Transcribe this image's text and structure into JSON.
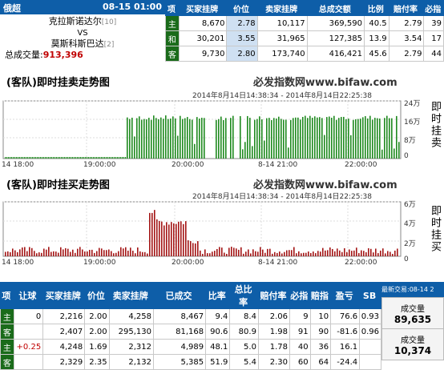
{
  "match": {
    "league": "俄超",
    "datetime": "08-15 01:00",
    "home": "克拉斯诺达尔",
    "home_rank": "[10]",
    "vs": "VS",
    "away": "莫斯科斯巴达",
    "away_rank": "[2]",
    "total_label": "总成交量:",
    "total_value": "913,396"
  },
  "top_table": {
    "headers": [
      "项",
      "买家挂牌",
      "价位",
      "卖家挂牌",
      "总成交额",
      "比例",
      "赔付率",
      "必指"
    ],
    "rows": [
      {
        "tag": "主",
        "buy": "8,670",
        "price": "2.78",
        "sell": "10,117",
        "total": "369,590",
        "ratio": "40.5",
        "payout": "2.79",
        "idx": "39"
      },
      {
        "tag": "和",
        "buy": "30,201",
        "price": "3.55",
        "sell": "31,965",
        "total": "127,385",
        "ratio": "13.9",
        "payout": "3.54",
        "idx": "17"
      },
      {
        "tag": "客",
        "buy": "9,730",
        "price": "2.80",
        "sell": "173,740",
        "total": "416,421",
        "ratio": "45.6",
        "payout": "2.79",
        "idx": "44"
      }
    ]
  },
  "chart1": {
    "title": "(客队)即时挂卖走势图",
    "site": "必发指数网www.bifaw.com",
    "timerange": "2014年8月14日14:38:34 - 2014年8月14日22:25:38",
    "side_label": "即时挂卖",
    "y_ticks": [
      "24万",
      "16万",
      "8万",
      "0"
    ],
    "x_ticks": [
      "14 18:00",
      "19:00:00",
      "20:00:00",
      "8-14 21:00",
      "22:00:00"
    ],
    "bar_color": "#1f8a1f"
  },
  "chart2": {
    "title": "(客队)即时挂买走势图",
    "site": "必发指数网www.bifaw.com",
    "timerange": "2014年8月14日14:38:34 - 2014年8月14日22:25:38",
    "side_label": "即时挂买",
    "y_ticks": [
      "6万",
      "4万",
      "2万",
      "0"
    ],
    "x_ticks": [
      "14 18:00",
      "19:00:00",
      "20:00:00",
      "8-14 21:00",
      "22:00:00"
    ],
    "bar_color": "#a31515"
  },
  "bottom_table": {
    "headers": [
      "项",
      "让球",
      "买家挂牌",
      "价位",
      "卖家挂牌",
      "已成交",
      "比率",
      "总比率",
      "赔付率",
      "必指",
      "赔指",
      "盈亏",
      "SB"
    ],
    "latest_label": "最新交易:08-14 2",
    "rows": [
      {
        "tag": "主",
        "handicap": "0",
        "buy": "2,216",
        "price": "2.00",
        "sell": "4,258",
        "done": "8,467",
        "ratio": "9.4",
        "total_ratio": "8.4",
        "payout": "2.06",
        "bz": "9",
        "pz": "10",
        "pl": "76.6",
        "sb": "0.93"
      },
      {
        "tag": "客",
        "handicap": "",
        "buy": "2,407",
        "price": "2.00",
        "sell": "295,130",
        "done": "81,168",
        "ratio": "90.6",
        "total_ratio": "80.9",
        "payout": "1.98",
        "bz": "91",
        "pz": "90",
        "pl": "-81.6",
        "sb": "0.96"
      },
      {
        "tag": "主",
        "handicap": "+0.25",
        "buy": "4,248",
        "price": "1.69",
        "sell": "2,312",
        "done": "4,989",
        "ratio": "48.1",
        "total_ratio": "5.0",
        "payout": "1.78",
        "bz": "40",
        "pz": "36",
        "pl": "16.1",
        "sb": ""
      },
      {
        "tag": "客",
        "handicap": "",
        "buy": "2,329",
        "price": "2.35",
        "sell": "2,132",
        "done": "5,385",
        "ratio": "51.9",
        "total_ratio": "5.4",
        "payout": "2.30",
        "bz": "60",
        "pz": "64",
        "pl": "-24.4",
        "sb": ""
      }
    ],
    "volume_boxes": [
      {
        "label": "成交量",
        "value": "89,635"
      },
      {
        "label": "成交量",
        "value": "10,374"
      }
    ]
  },
  "colors": {
    "header_blue": "#0e5ea8",
    "tag_green": "#1a6b1a",
    "accent_red": "#c00000"
  }
}
